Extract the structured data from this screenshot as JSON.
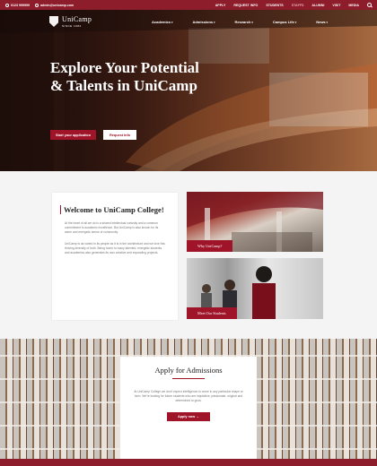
{
  "topbar": {
    "phone": "0123 999999",
    "email": "admin@unicamp.com",
    "links": [
      "APPLY",
      "REQUEST INFO",
      "STUDENTS",
      "STAFFS",
      "ALUMNI",
      "VISIT",
      "MEDIA"
    ],
    "active_link": "STAFFS"
  },
  "brand": {
    "name": "UniCamp",
    "since": "SINCE 1982"
  },
  "nav": {
    "items": [
      "Academics",
      "Admissions",
      "Research",
      "Campus Life",
      "News"
    ]
  },
  "hero": {
    "title": "Explore Your Potential & Talents in UniCamp",
    "apply_label": "Start your application",
    "info_label": "Request Info"
  },
  "welcome": {
    "title": "Welcome to UniCamp College!",
    "p1": "At the heart of all we do is a shared intellectual curiosity and a common commitment to academic excellence. But UniCamp is also known for its warm and energetic sense of community.",
    "p2": "UniCamp is as varied in its people as it is in the architecture and we love this thriving diversity of both. Being home to many talented, energetic students and academics also generates its own creative and expanding projects."
  },
  "cards": {
    "why_label": "Why UniCamp?",
    "students_label": "Meet Our Students"
  },
  "admissions": {
    "title": "Apply for Admissions",
    "text": "At UniCamp College we don't expect intelligence to come in any particular shape or form. We're looking for future students who are inquisitive, passionate, original and determined to grow.",
    "button": "Apply now →"
  },
  "colors": {
    "brand": "#8e1d2c",
    "accent": "#a0142a"
  }
}
